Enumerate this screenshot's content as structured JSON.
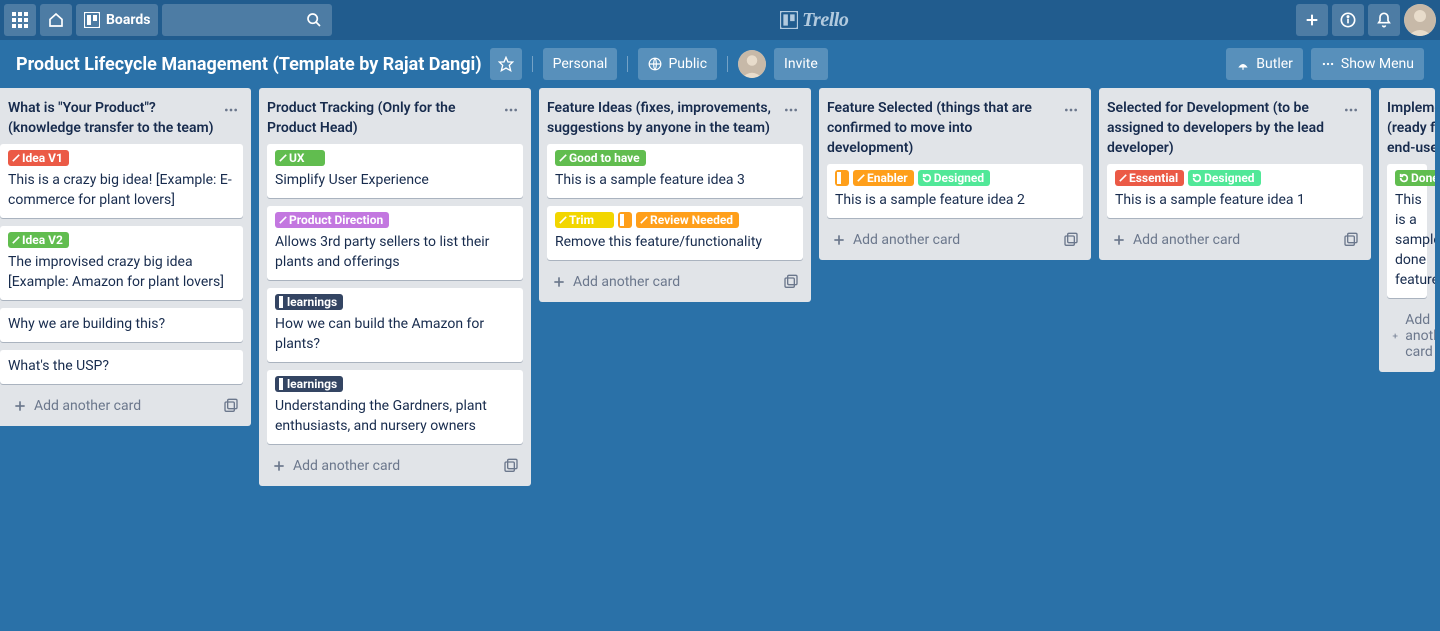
{
  "header": {
    "boards_label": "Boards",
    "logo_text": "Trello"
  },
  "boardbar": {
    "title": "Product Lifecycle Management (Template by Rajat Dangi)",
    "team_label": "Personal",
    "visibility_label": "Public",
    "invite_label": "Invite",
    "butler_label": "Butler",
    "menu_label": "Show Menu"
  },
  "add_card_label": "Add another card",
  "lists": [
    {
      "title": "What is \"Your Product\"? (knowledge transfer to the team)",
      "cards": [
        {
          "labels": [
            {
              "color": "red",
              "text": "Idea V1"
            }
          ],
          "text": "This is a crazy big idea! [Example: E-commerce for plant lovers]"
        },
        {
          "labels": [
            {
              "color": "green",
              "text": "Idea V2"
            }
          ],
          "text": "The improvised crazy big idea [Example: Amazon for plant lovers]"
        },
        {
          "labels": [],
          "text": "Why we are building this?"
        },
        {
          "labels": [],
          "text": "What's the USP?"
        }
      ]
    },
    {
      "title": "Product Tracking (Only for the Product Head)",
      "cards": [
        {
          "labels": [
            {
              "color": "green",
              "text": "UX",
              "pad": true
            }
          ],
          "text": "Simplify User Experience"
        },
        {
          "labels": [
            {
              "color": "purple",
              "text": "Product Direction"
            }
          ],
          "text": "Allows 3rd party sellers to list their plants and offerings"
        },
        {
          "labels": [
            {
              "color": "navy",
              "text": "learnings",
              "bar": true
            }
          ],
          "text": "How we can build the Amazon for plants?"
        },
        {
          "labels": [
            {
              "color": "navy",
              "text": "learnings",
              "bar": true
            }
          ],
          "text": "Understanding the Gardners, plant enthusiasts, and nursery owners"
        }
      ]
    },
    {
      "title": "Feature Ideas (fixes, improvements, suggestions by anyone in the team)",
      "cards": [
        {
          "labels": [
            {
              "color": "green",
              "text": "Good to have"
            }
          ],
          "text": "This is a sample feature idea 3"
        },
        {
          "labels": [
            {
              "color": "yellow",
              "text": "Trim",
              "pad": true
            },
            {
              "color": "orange",
              "text": "",
              "bar": true
            },
            {
              "color": "orange",
              "text": "Review Needed"
            }
          ],
          "text": "Remove this feature/functionality"
        }
      ]
    },
    {
      "title": "Feature Selected (things that are confirmed to move into development)",
      "cards": [
        {
          "labels": [
            {
              "color": "orange",
              "text": "",
              "bar": true
            },
            {
              "color": "orange",
              "text": "Enabler"
            },
            {
              "color": "teal",
              "text": "Designed",
              "loop": true
            }
          ],
          "text": "This is a sample feature idea 2"
        }
      ]
    },
    {
      "title": "Selected for Development (to be assigned to developers by the lead developer)",
      "cards": [
        {
          "labels": [
            {
              "color": "red",
              "text": "Essential"
            },
            {
              "color": "teal",
              "text": "Designed",
              "loop": true
            }
          ],
          "text": "This is a sample feature idea 1"
        }
      ]
    },
    {
      "title": "Implemented (ready for end-user)",
      "cards": [
        {
          "labels": [
            {
              "color": "green",
              "text": "Done",
              "loop": true
            }
          ],
          "text": "This is a sample done feature"
        }
      ]
    }
  ]
}
